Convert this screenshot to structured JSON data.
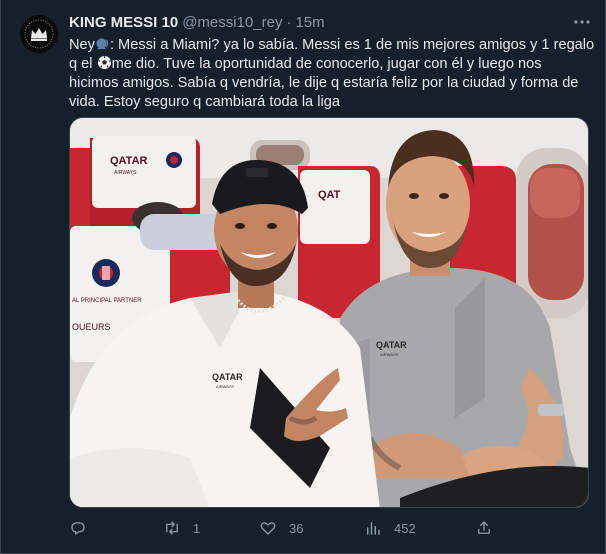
{
  "tweet": {
    "author_name": "KING MESSI 10",
    "handle": "@messi10_rey",
    "separator": "·",
    "time": "15m",
    "text_start": "Ney",
    "text_after_emoji1": ": Messi a Miami? ya lo sabía. Messi es 1 de mis mejores amigos y 1 regalo q el ",
    "text_after_emoji2": "me dio. Tuve la oportunidad de conocerlo, jugar con él y luego nos hicimos amigos. Sabía q vendría, le dije q estaría feliz por la ciudad y forma de vida. Estoy seguro q cambiará toda la liga",
    "emoji1_icon": "speaking-head-icon",
    "emoji2_icon": "soccer-ball-icon"
  },
  "media": {
    "seat_brand": "QATAR",
    "seat_brand_sub": "AIRWAYS",
    "shirt_brand": "QATAR",
    "shirt_brand_sub": "AIRWAYS",
    "partner_text": "AL PRINCIPAL PARTNER",
    "seat_text": "OUEURS"
  },
  "actions": {
    "reply_count": "",
    "retweet_count": "1",
    "like_count": "36",
    "views_count": "452",
    "share_count": ""
  },
  "colors": {
    "background": "#15202b",
    "text": "#e7e9ea",
    "muted": "#8b98a5",
    "border": "#38444d"
  }
}
